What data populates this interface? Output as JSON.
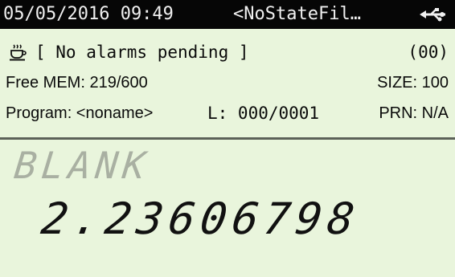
{
  "title_bar": {
    "datetime": "05/05/2016 09:49",
    "state_file": "<NoStateFil…",
    "usb_icon": "usb-connection-icon"
  },
  "status": {
    "alarm_icon": "coffee-cup-icon",
    "alarm_text": "[ No alarms pending ]",
    "alarm_count": "(00)",
    "free_mem": "Free MEM: 219/600",
    "size": "SIZE: 100",
    "program": "Program: <noname>",
    "location": "L: 000/0001",
    "printer": "PRN: N/A"
  },
  "display": {
    "annunciator": "BLANK",
    "value": "2.23606798"
  },
  "colors": {
    "background": "#e9f5dc",
    "title_bar": "#060606",
    "annunciator": "#a9b0a2",
    "digits": "#111111"
  }
}
